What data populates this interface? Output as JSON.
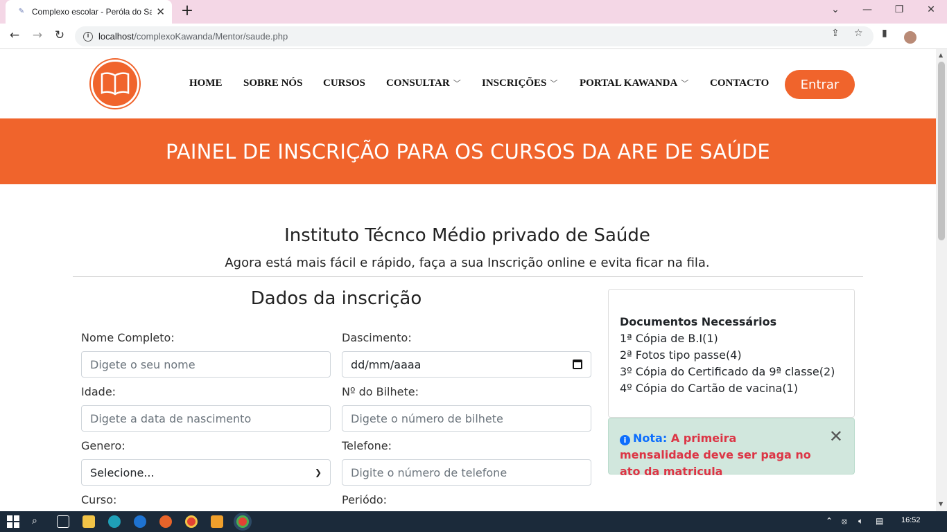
{
  "browser": {
    "tab_title": "Complexo escolar - Peróla do Saúde",
    "url_host": "localhost",
    "url_path": "/complexoKawanda/Mentor/saude.php"
  },
  "nav": {
    "items": [
      "HOME",
      "SOBRE NÓS",
      "CURSOS",
      "CONSULTAR",
      "INSCRIÇÕES",
      "PORTAL KAWANDA",
      "CONTACTO"
    ],
    "login_button": "Entrar"
  },
  "banner": {
    "title": "PAINEL DE INSCRIÇÃO PARA OS CURSOS DA ARE DE SAÚDE"
  },
  "institute": {
    "title": "Instituto Técnco Médio privado de Saúde",
    "subtitle": "Agora está mais fácil e rápido, faça a sua Inscrição online e evita ficar na fila."
  },
  "form": {
    "title": "Dados da inscrição",
    "nome_label": "Nome Completo:",
    "nome_placeholder": "Digete o seu nome",
    "nascimento_label": "Dascimento:",
    "nascimento_value": "dd/mm/aaaa",
    "idade_label": "Idade:",
    "idade_placeholder": "Digete a data de nascimento",
    "bilhete_label": "Nº do Bilhete:",
    "bilhete_placeholder": "Digete o número de bilhete",
    "genero_label": "Genero:",
    "genero_value": "Selecione...",
    "telefone_label": "Telefone:",
    "telefone_placeholder": "Digite o número de telefone",
    "curso_label": "Curso:",
    "periodo_label": "Periódo:"
  },
  "docs": {
    "title": "Documentos Necessários",
    "items": [
      "1ª Cópia de B.I(1)",
      "2ª Fotos tipo passe(4)",
      "3º Cópia do Certificado da 9ª classe(2)",
      "4º Cópia do Cartão de vacina(1)"
    ]
  },
  "alert": {
    "label": "Nota:",
    "message": "A primeira mensalidade deve ser paga no ato da matricula"
  },
  "taskbar": {
    "time": "16:52"
  },
  "colors": {
    "brand": "#f0642c",
    "alert_bg": "#d1e7dd",
    "alert_text": "#dc3545",
    "info": "#0d6efd"
  }
}
